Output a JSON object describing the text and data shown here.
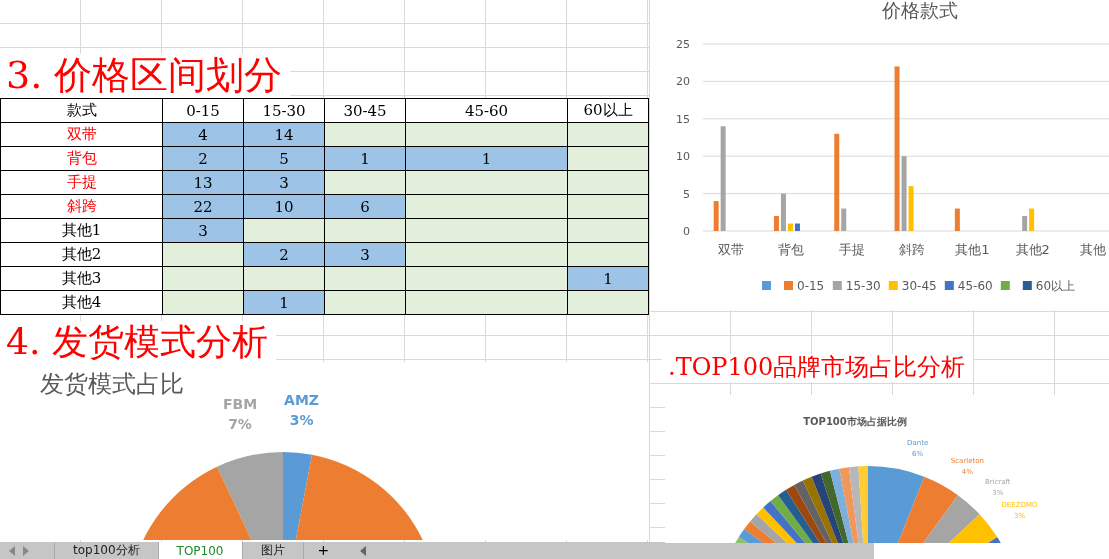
{
  "price_section": {
    "title": "3. 价格区间划分",
    "table": {
      "columns": [
        "款式",
        "0-15",
        "15-30",
        "30-45",
        "45-60",
        "60以上"
      ],
      "rows": [
        {
          "color": "#ff0000",
          "cells": [
            "双带",
            "4",
            "14",
            "",
            "",
            ""
          ]
        },
        {
          "color": "#ff0000",
          "cells": [
            "背包",
            "2",
            "5",
            "1",
            "1",
            ""
          ]
        },
        {
          "color": "#ff0000",
          "cells": [
            "手提",
            "13",
            "3",
            "",
            "",
            ""
          ]
        },
        {
          "color": "#ff0000",
          "cells": [
            "斜跨",
            "22",
            "10",
            "6",
            "",
            ""
          ]
        },
        {
          "color": "#000000",
          "cells": [
            "其他1",
            "3",
            "",
            "",
            "",
            ""
          ]
        },
        {
          "color": "#000000",
          "cells": [
            "其他2",
            "",
            "2",
            "3",
            "",
            ""
          ]
        },
        {
          "color": "#000000",
          "cells": [
            "其他3",
            "",
            "",
            "",
            "",
            "1"
          ]
        },
        {
          "color": "#000000",
          "cells": [
            "其他4",
            "",
            "1",
            "",
            "",
            ""
          ]
        }
      ]
    }
  },
  "price_chart": {
    "chart_data": {
      "type": "bar",
      "title": "价格款式",
      "categories": [
        "双带",
        "背包",
        "手提",
        "斜跨",
        "其他1",
        "其他2",
        "其他"
      ],
      "grid": true,
      "legend": true,
      "ylim": [
        0,
        25
      ],
      "yticks": [
        0,
        5,
        10,
        15,
        20,
        25
      ],
      "series": [
        {
          "color": "#5b9bd5",
          "values": [
            null,
            null,
            null,
            null,
            null,
            null,
            null
          ]
        },
        {
          "name": "0-15",
          "color": "#ed7d31",
          "values": [
            4,
            2,
            13,
            22,
            3,
            null,
            null
          ]
        },
        {
          "name": "15-30",
          "color": "#a5a5a5",
          "values": [
            14,
            5,
            3,
            10,
            null,
            2,
            null
          ]
        },
        {
          "name": "30-45",
          "color": "#ffc000",
          "values": [
            null,
            1,
            null,
            6,
            null,
            3,
            null
          ]
        },
        {
          "name": "45-60",
          "color": "#4472c4",
          "values": [
            null,
            1,
            null,
            null,
            null,
            null,
            null
          ]
        },
        {
          "color": "#70ad47",
          "values": [
            null,
            null,
            null,
            null,
            null,
            null,
            null
          ]
        },
        {
          "name": "60以上",
          "color": "#255e91",
          "values": [
            null,
            null,
            null,
            null,
            null,
            null,
            null
          ]
        }
      ]
    }
  },
  "shipping_section": {
    "title": "4. 发货模式分析",
    "chart": {
      "title": "发货模式占比",
      "slices": [
        {
          "label": "FBM",
          "value": "7%",
          "color": "#a5a5a5"
        },
        {
          "label": "AMZ",
          "value": "3%",
          "color": "#5b9bd5"
        },
        {
          "color": "#ed7d31"
        }
      ]
    }
  },
  "brand_section": {
    "title": ".TOP100品牌市场占比分析",
    "chart": {
      "title": "TOP100市场占据比例",
      "slices": [
        {
          "label": "Dante",
          "value": "6%",
          "color": "#5b9bd5"
        },
        {
          "label": "Scarleton",
          "value": "4%",
          "color": "#ed7d31"
        },
        {
          "label": "Bricraft",
          "value": "3%",
          "color": "#a5a5a5"
        },
        {
          "label": "DEEZOMO",
          "value": "3%",
          "color": "#ffc000"
        }
      ]
    }
  },
  "sheet_tabs": [
    {
      "label": "top100分析",
      "selected": false
    },
    {
      "label": "TOP100",
      "selected": true
    },
    {
      "label": "图片",
      "selected": false
    }
  ],
  "add_sheet": "+"
}
